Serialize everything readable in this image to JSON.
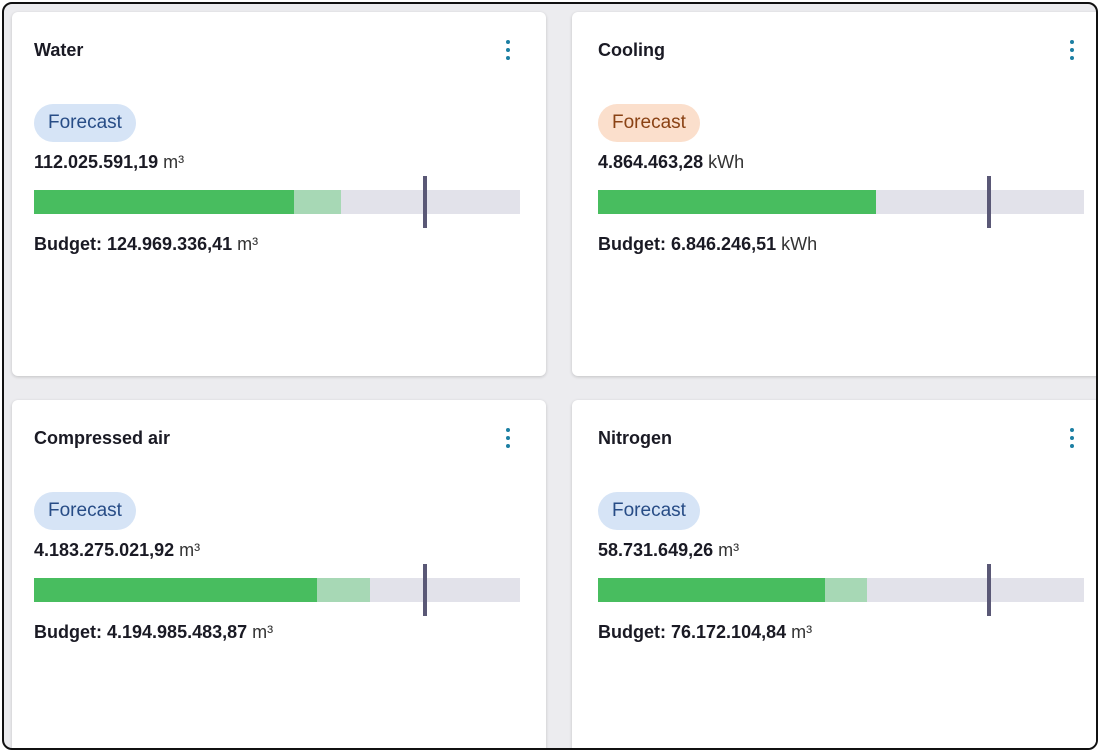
{
  "cards": [
    {
      "title": "Water",
      "badge": "Forecast",
      "badge_color": "#d6e4f6",
      "value": "112.025.591,19",
      "unit": "m³",
      "budget_label": "Budget:",
      "budget_value": "124.969.336,41",
      "budget_unit": "m³",
      "actual_fraction": 0.536,
      "forecast_fraction": 0.631,
      "budget_marker_fraction": 0.805
    },
    {
      "title": "Cooling",
      "badge": "Forecast",
      "badge_color": "#fbdfcc",
      "value": "4.864.463,28",
      "unit": "kWh",
      "budget_label": "Budget:",
      "budget_value": "6.846.246,51",
      "budget_unit": "kWh",
      "actual_fraction": 0.571,
      "forecast_fraction": 0.571,
      "budget_marker_fraction": 0.805
    },
    {
      "title": "Compressed air",
      "badge": "Forecast",
      "badge_color": "#d6e4f6",
      "value": "4.183.275.021,92",
      "unit": "m³",
      "budget_label": "Budget:",
      "budget_value": "4.194.985.483,87",
      "budget_unit": "m³",
      "actual_fraction": 0.583,
      "forecast_fraction": 0.691,
      "budget_marker_fraction": 0.805
    },
    {
      "title": "Nitrogen",
      "badge": "Forecast",
      "badge_color": "#d6e4f6",
      "value": "58.731.649,26",
      "unit": "m³",
      "budget_label": "Budget:",
      "budget_value": "76.172.104,84",
      "budget_unit": "m³",
      "actual_fraction": 0.468,
      "forecast_fraction": 0.553,
      "budget_marker_fraction": 0.805
    }
  ],
  "colors": {
    "actual_bar": "#48bd5f",
    "forecast_bar": "#a7d8b5",
    "track": "#e2e2ea",
    "budget_marker": "#5a5876",
    "menu_icon": "#1c7fa3"
  },
  "icons": {
    "card_menu": "more-vertical-icon"
  }
}
